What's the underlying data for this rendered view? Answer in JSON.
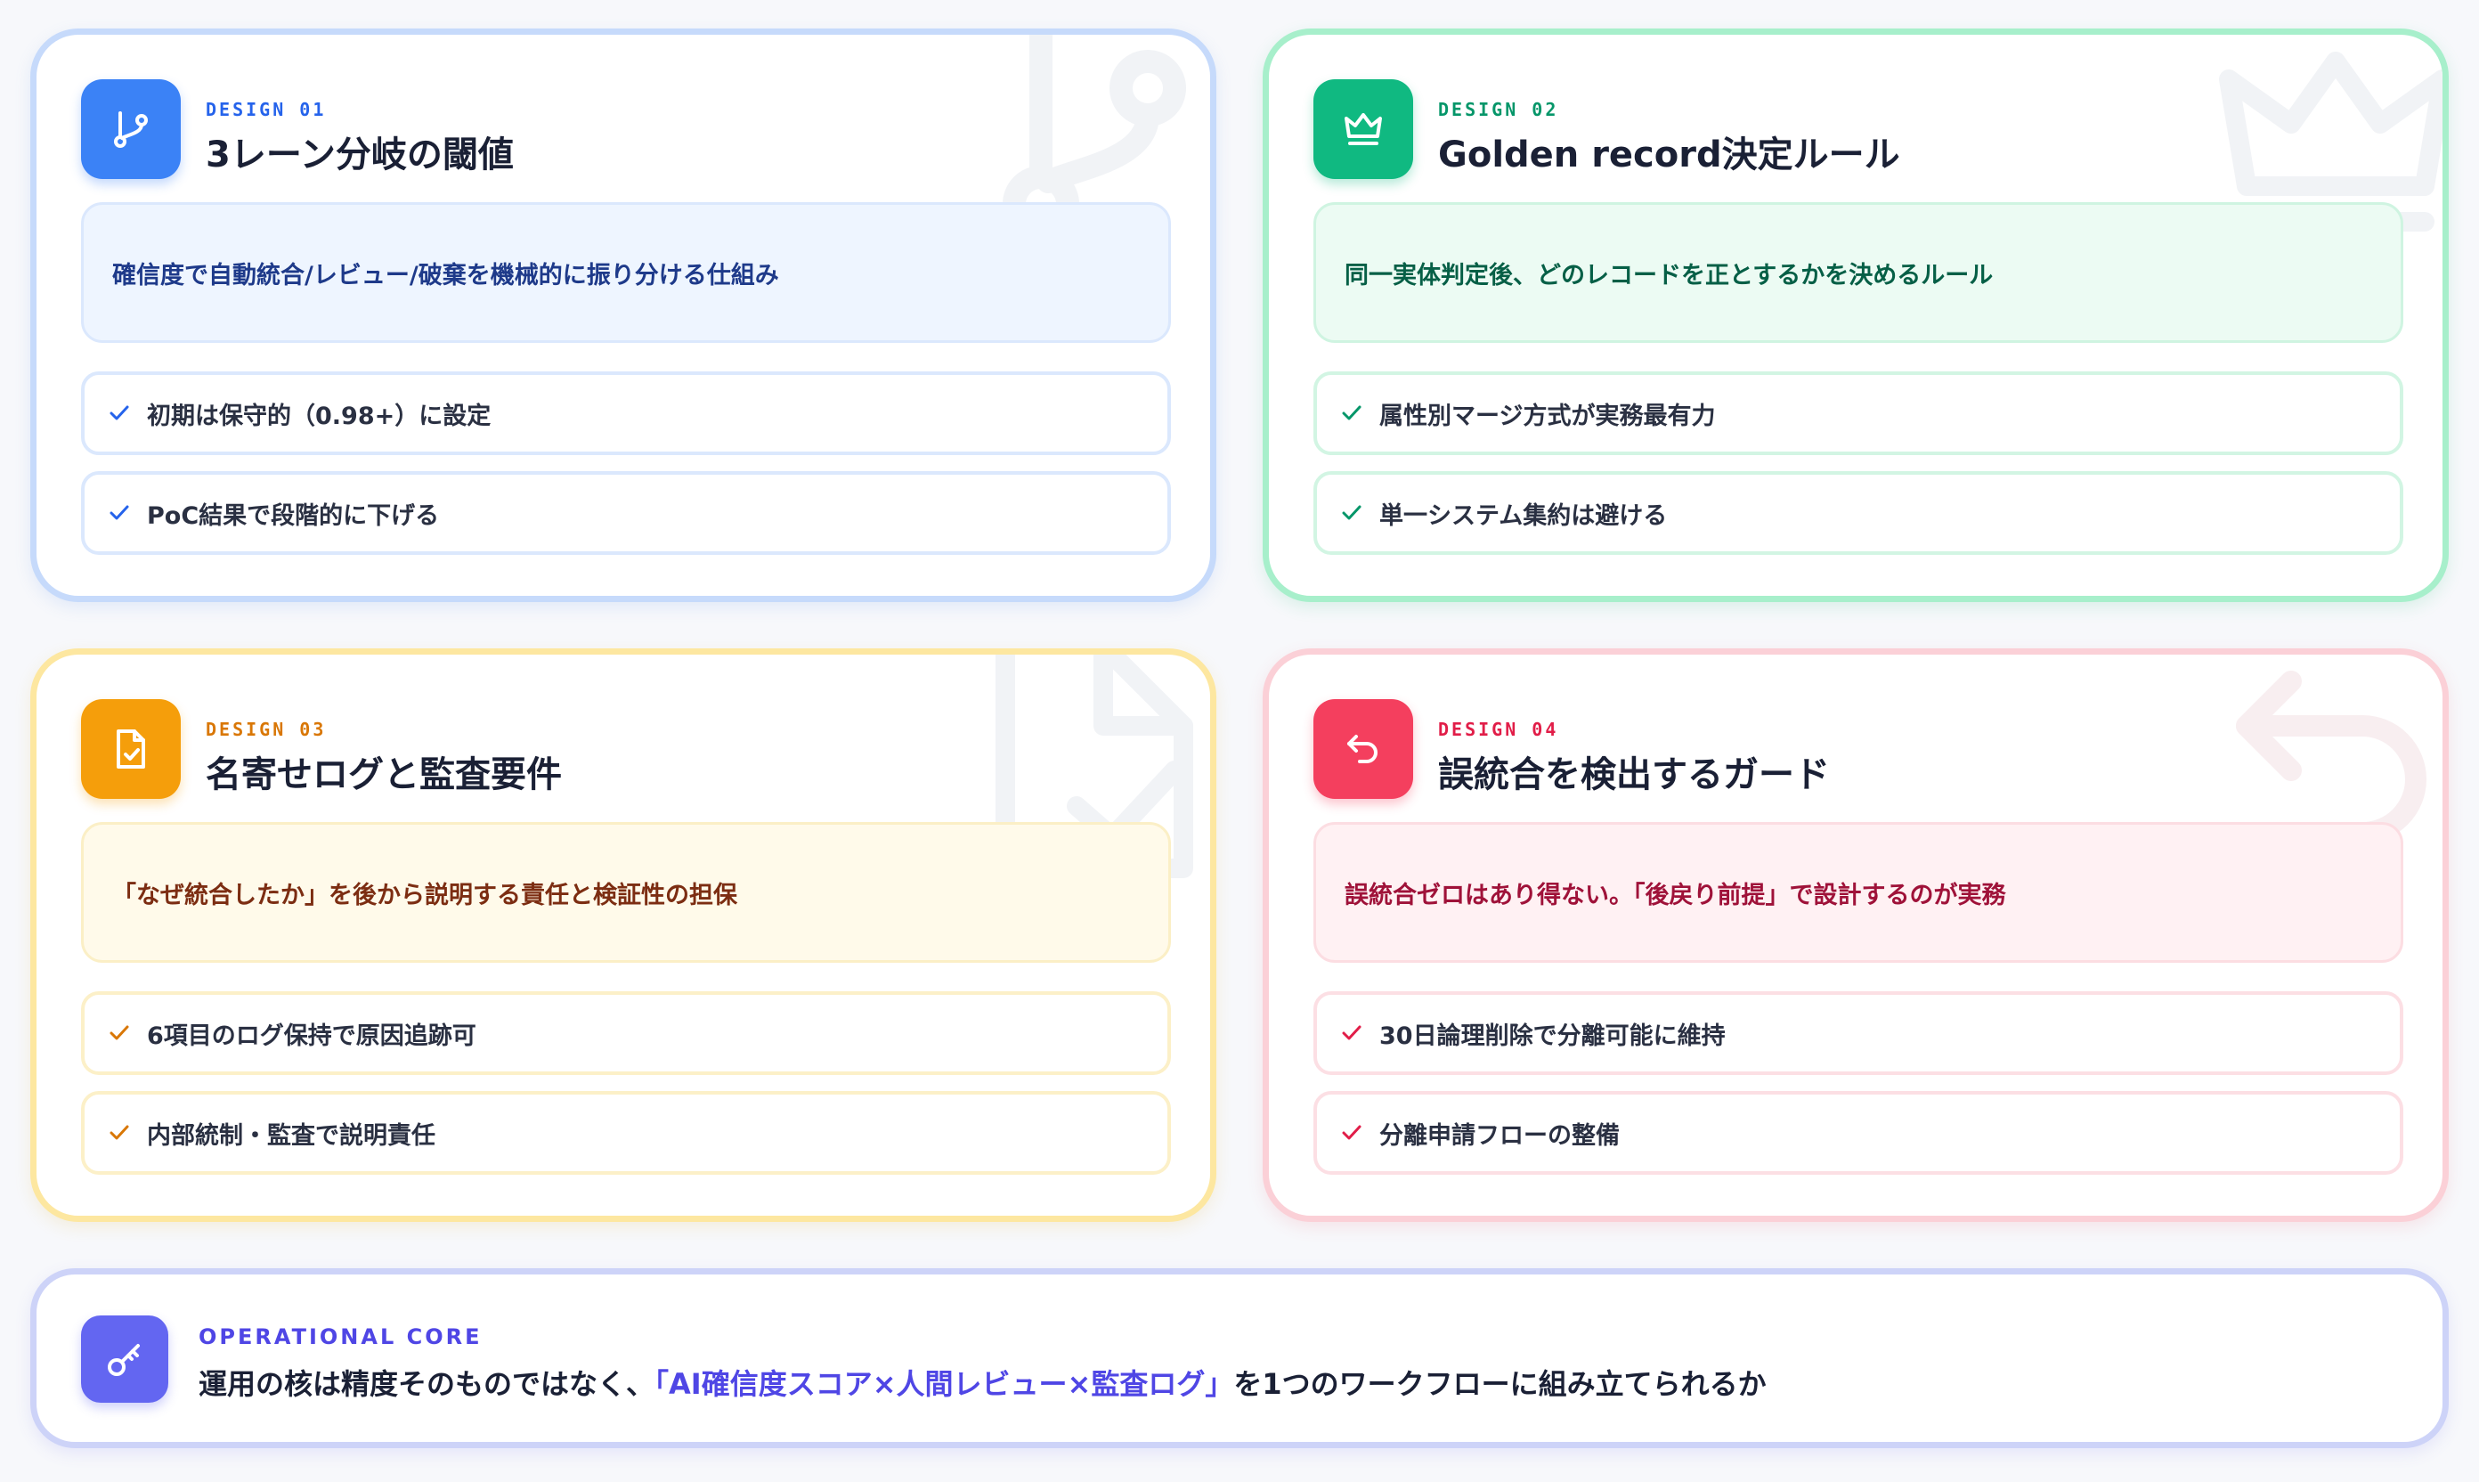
{
  "cards": [
    {
      "eyebrow": "DESIGN 01",
      "title": "3レーン分岐の閾値",
      "icon": "git-branch-icon",
      "color": "#3b82f6",
      "description": "確信度で自動統合/レビュー/破棄を機械的に振り分ける仕組み",
      "points": [
        "初期は保守的（0.98+）に設定",
        "PoC結果で段階的に下げる"
      ]
    },
    {
      "eyebrow": "DESIGN 02",
      "title": "Golden record決定ルール",
      "icon": "crown-icon",
      "color": "#10b981",
      "description": "同一実体判定後、どのレコードを正とするかを決めるルール",
      "points": [
        "属性別マージ方式が実務最有力",
        "単一システム集約は避ける"
      ]
    },
    {
      "eyebrow": "DESIGN 03",
      "title": "名寄せログと監査要件",
      "icon": "file-check-icon",
      "color": "#f59e0b",
      "description": "「なぜ統合したか」を後から説明する責任と検証性の担保",
      "points": [
        "6項目のログ保持で原因追跡可",
        "内部統制・監査で説明責任"
      ]
    },
    {
      "eyebrow": "DESIGN 04",
      "title": "誤統合を検出するガード",
      "icon": "undo-arrow-icon",
      "color": "#f43f5e",
      "description": "誤統合ゼロはあり得ない。「後戻り前提」で設計するのが実務",
      "points": [
        "30日論理削除で分離可能に維持",
        "分離申請フローの整備"
      ]
    }
  ],
  "core": {
    "eyebrow": "OPERATIONAL CORE",
    "icon": "key-icon",
    "color": "#6366f1",
    "text_before": "運用の核は精度そのものではなく、",
    "text_highlight": "「AI確信度スコア×人間レビュー×監査ログ」",
    "text_after": "を1つのワークフローに組み立てられるか"
  }
}
